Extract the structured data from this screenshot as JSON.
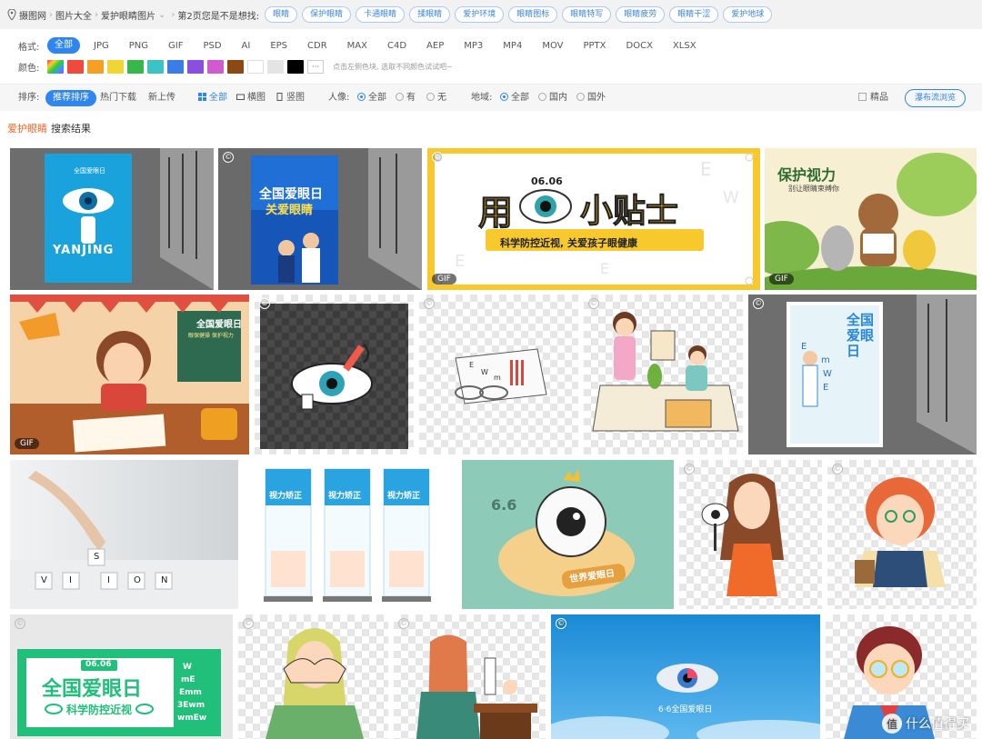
{
  "breadcrumb": {
    "site": "摄图网",
    "level1": "图片大全",
    "level2": "爱护眼睛图片",
    "page_hint": "第2页您是不是想找:",
    "tags": [
      "眼睛",
      "保护眼睛",
      "卡通眼睛",
      "揉眼睛",
      "爱护环境",
      "眼睛图标",
      "眼睛特写",
      "眼睛疲劳",
      "眼睛干涩",
      "爱护地球"
    ]
  },
  "filters": {
    "format_label": "格式:",
    "formats": [
      "全部",
      "JPG",
      "PNG",
      "GIF",
      "PSD",
      "AI",
      "EPS",
      "CDR",
      "MAX",
      "C4D",
      "AEP",
      "MP3",
      "MP4",
      "MOV",
      "PPTX",
      "DOCX",
      "XLSX"
    ],
    "color_label": "颜色:",
    "colors": [
      "#ef4a3c",
      "#f5a023",
      "#f0d634",
      "#36b84a",
      "#3cc4c4",
      "#3a7de8",
      "#8a4fe0",
      "#d05ad0",
      "#8b4a14",
      "#ffffff",
      "#e4e4e4",
      "#000000"
    ],
    "more_label": "···",
    "color_hint": "点击左侧色块, 选取不同颜色试试吧~"
  },
  "sortbar": {
    "sort_label": "排序:",
    "sort_active": "推荐排序",
    "sort_hot": "热门下载",
    "sort_new": "新上传",
    "layout_all": "全部",
    "layout_landscape": "横图",
    "layout_portrait": "竖图",
    "people_label": "人像:",
    "people_all": "全部",
    "people_yes": "有",
    "people_no": "无",
    "region_label": "地域:",
    "region_all": "全部",
    "region_domestic": "国内",
    "region_foreign": "国外",
    "premium": "精品",
    "waterfall": "瀑布流浏览"
  },
  "result": {
    "keyword": "爱护眼睛",
    "suffix": "搜索结果"
  },
  "tiles": {
    "t1_text": "YANJING",
    "t1_title": "全国爱眼日",
    "t2_line1": "全国爱眼日",
    "t2_line2": "关爱眼睛",
    "t3_date": "06.06",
    "t3_char1": "用",
    "t3_chars": "小贴士",
    "t3_sub": "科学防控近视, 关爱孩子眼健康",
    "t4_title": "保护视力",
    "t4_sub": "别让眼睛束缚你",
    "t5_title": "全国爱眼日",
    "t5_sub": "眼保健操 保护视力",
    "t9_title": "全国爱眼日",
    "t10_letters": [
      "V",
      "I",
      "S",
      "I",
      "O",
      "N"
    ],
    "t11_title": "视力矫正",
    "t12_date": "6.6",
    "t12_sub": "世界爱眼日",
    "t15_date": "06.06",
    "t15_title": "全国爱眼日",
    "t15_sub": "科学防控近视",
    "t18_text": "6·6全国爱眼日",
    "gif_label": "GIF",
    "copy_label": "©",
    "watermark_text": "什么值得买",
    "watermark_icon": "值"
  }
}
